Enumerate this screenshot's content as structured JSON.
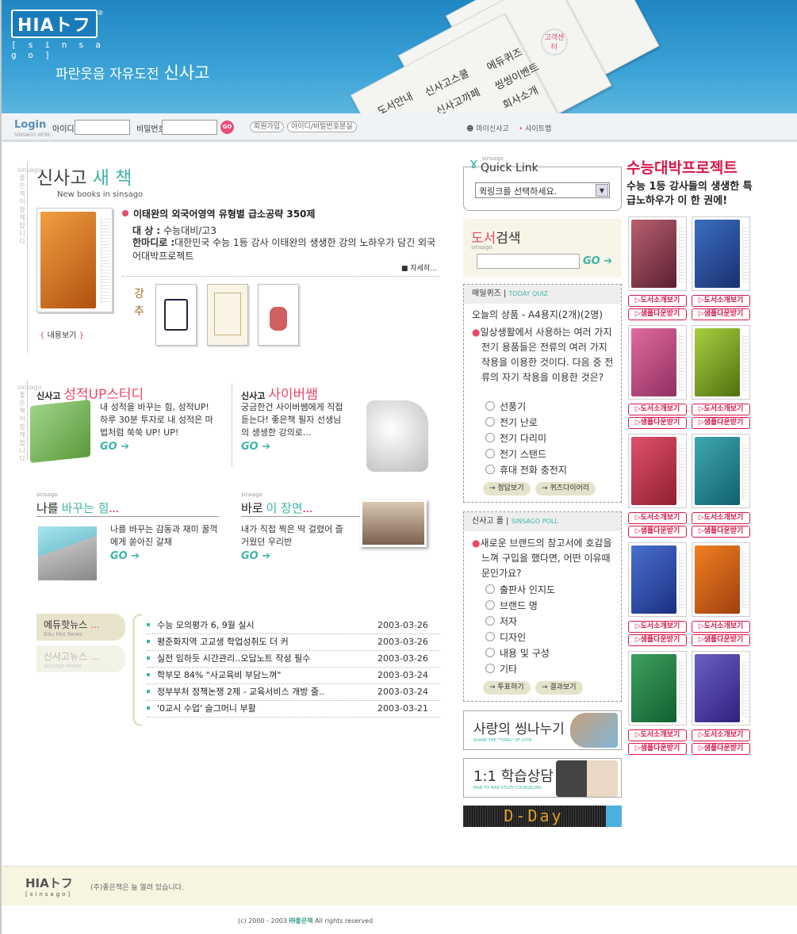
{
  "brand": {
    "logo": "HIAトフ",
    "logo_sub": "[ s i n s a g o ]",
    "slogan": "파란웃음 자유도전",
    "slogan_brand": "신사고",
    "cs_badge": "고객센터"
  },
  "nav": [
    "도서안내",
    "신사고스쿨",
    "신사고까페",
    "에듀퀴즈",
    "씽씽이벤트",
    "회사소개"
  ],
  "login": {
    "title": "Login",
    "title_sub": "SINSAGO HERE",
    "id_label": "아이디",
    "pw_label": "비밀번호",
    "go": "GO",
    "join": "회원가입",
    "find": "아이디/비밀번호분실",
    "my": "마이신사고",
    "sitemap": "사이트맵"
  },
  "newbook": {
    "side_label": "sinsago 좋은책이함께합니다",
    "heading": "신사고",
    "heading_accent": "새 책",
    "sub": "New books in sinsago",
    "title": "이태완의 외국어영역 유형별 급소공략 350제",
    "target_label": "대 상 :",
    "target": "수능대비/고3",
    "summary_label": "한마디로 :",
    "summary": "대한민국 수능 1등 강사 이태완의 생생한 강의 노하우가 담긴 외국어대박프로젝트",
    "detail": "■ 자세히...",
    "view": "내용보기",
    "recommend": "강추"
  },
  "study": {
    "brand": "신사고",
    "title": "성적UP스터디",
    "desc": "내 성적을 바꾸는 힘, 성적UP! 하루 30분 투자로 내 성적은 마법처럼 쑥쑥 UP! UP!",
    "go": "GO"
  },
  "cyber": {
    "brand": "신사고",
    "title": "사이버쌤",
    "desc": "궁금한건 사이버쌤에게 직접 듣는다! 좋은책 필자 선생님의 생생한 강의로...",
    "go": "GO"
  },
  "power": {
    "tag": "sinsago",
    "title_a": "나를",
    "title_b": "바꾸는 힘",
    "desc": "나를 바꾸는 감동과 재미 꿀꺽에게 쏟아진 갈채",
    "go": "GO"
  },
  "scene": {
    "tag": "sinsago",
    "title_a": "바로",
    "title_b": "이 장면",
    "desc": "내가 직접 찍은 딱 걸렸어 즐거웠던 우리반",
    "go": "GO"
  },
  "news": {
    "tab1": "에듀핫뉴스",
    "tab1_sub": "Edu Hot News",
    "tab2": "신사고뉴스",
    "tab2_sub": "sinsago News",
    "items": [
      {
        "title": "수능 모의평가 6, 9월 실시",
        "date": "2003-03-26"
      },
      {
        "title": "평준화지역 고교생 학업성취도 더 커",
        "date": "2003-03-26"
      },
      {
        "title": "실전 임하듯 시간관리‥오답노트 작성 필수",
        "date": "2003-03-26"
      },
      {
        "title": "학부모 84% \"사교육비 부담느껴\"",
        "date": "2003-03-24"
      },
      {
        "title": "정부부처 정책논쟁 2제 - 교육서비스 개방 줄..",
        "date": "2003-03-24"
      },
      {
        "title": "'0교시 수업' 슬그머니 부활",
        "date": "2003-03-21"
      }
    ]
  },
  "quicklink": {
    "tag": "sinsago",
    "title": "Quick Link",
    "select": "퀵링크를 선택하세요."
  },
  "search": {
    "title_a": "도서",
    "title_b": "검색",
    "tag": "sinsago",
    "go": "GO"
  },
  "quiz": {
    "head": "매일퀴즈",
    "head_en": "TODAY QUIZ",
    "prize": "오늘의 상품 - A4용지(2개)(2명)",
    "question": "일상생활에서 사용하는 여러 가지 전기 용품들은 전류의 여러 가지 작용을 이용한 것이다. 다음 중 전류의 자기 작용을 이용한 것은?",
    "options": [
      "선풍기",
      "전기 난로",
      "전기 다리미",
      "전기 스탠드",
      "휴대 전화 충전지"
    ],
    "btn1": "정답보기",
    "btn2": "퀴즈다이어리"
  },
  "poll": {
    "head": "신사고 폴",
    "head_en": "SINSAGO POLL",
    "question": "새로운 브랜드의 참고서에 호감을 느껴 구입을 했다면, 어떤 이유때문인가요?",
    "options": [
      "출판사 인지도",
      "브랜드 명",
      "저자",
      "디자인",
      "내용 및 구성",
      "기타"
    ],
    "btn1": "투표하기",
    "btn2": "결과보기"
  },
  "banners": {
    "love": "사랑의 씽나누기",
    "love_sub": "SHARE THE \"THING\" OF LOVE",
    "counsel": "1:1 학습상담",
    "counsel_sub": "MAN TO MAN STUDY COUNSELING",
    "dday": "D-Day"
  },
  "project": {
    "title": "수능대박프로젝트",
    "sub": "수능 1등 강사들의 생생한 특급노하우가 이 한 권에!",
    "btn_intro": "▷도서소개보기",
    "btn_sample": "▷샘플다운받기"
  },
  "footer": {
    "logo": "HIAトフ",
    "logo_sub": "[sinsago]",
    "note": "(주)좋은책은 늘 열려 있습니다.",
    "copyright": "(c) 2000 - 2003",
    "company": "㈜좋은책",
    "rights": "All rights reserved"
  },
  "colors": {
    "header_blue": "#2a93cb",
    "accent_pink": "#e84a6a",
    "accent_teal": "#3fb6a8",
    "project_red": "#d8184a"
  }
}
